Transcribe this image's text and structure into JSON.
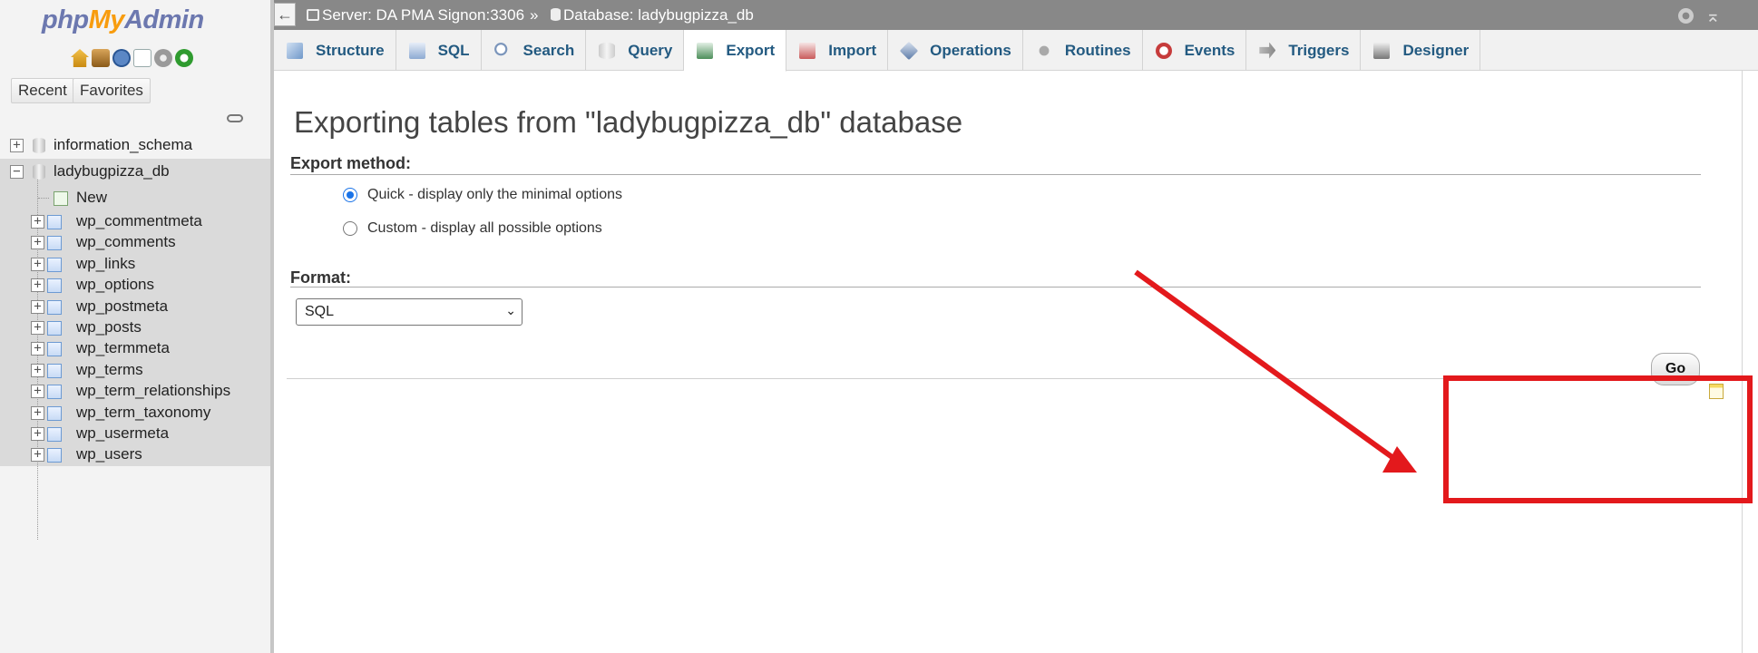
{
  "app": {
    "logo": {
      "php": "php",
      "my": "My",
      "admin": "Admin"
    },
    "quick_icons": [
      "home-icon",
      "database-icon",
      "docs-icon",
      "copy-icon",
      "settings-icon",
      "reload-icon"
    ]
  },
  "sidebar": {
    "recent_label": "Recent",
    "favorites_label": "Favorites",
    "databases": [
      {
        "name": "information_schema",
        "expanded": false
      },
      {
        "name": "ladybugpizza_db",
        "expanded": true
      }
    ],
    "new_label": "New",
    "tables": [
      "wp_commentmeta",
      "wp_comments",
      "wp_links",
      "wp_options",
      "wp_postmeta",
      "wp_posts",
      "wp_termmeta",
      "wp_terms",
      "wp_term_relationships",
      "wp_term_taxonomy",
      "wp_usermeta",
      "wp_users"
    ]
  },
  "breadcrumb": {
    "server": "Server: DA PMA Signon:3306",
    "separator": "»",
    "database": "Database: ladybugpizza_db"
  },
  "tabs": [
    {
      "label": "Structure",
      "icon": "structure-icon"
    },
    {
      "label": "SQL",
      "icon": "sql-icon"
    },
    {
      "label": "Search",
      "icon": "search-icon"
    },
    {
      "label": "Query",
      "icon": "query-icon"
    },
    {
      "label": "Export",
      "icon": "export-icon",
      "active": true
    },
    {
      "label": "Import",
      "icon": "import-icon"
    },
    {
      "label": "Operations",
      "icon": "operations-icon"
    },
    {
      "label": "Routines",
      "icon": "routines-icon"
    },
    {
      "label": "Events",
      "icon": "events-icon"
    },
    {
      "label": "Triggers",
      "icon": "triggers-icon"
    },
    {
      "label": "Designer",
      "icon": "designer-icon"
    }
  ],
  "main": {
    "title": "Exporting tables from \"ladybugpizza_db\" database",
    "export_method_label": "Export method:",
    "options": [
      {
        "label": "Quick - display only the minimal options",
        "checked": true
      },
      {
        "label": "Custom - display all possible options",
        "checked": false
      }
    ],
    "format_label": "Format:",
    "format_value": "SQL",
    "go_label": "Go"
  },
  "colors": {
    "tab_text": "#235a81",
    "annotation_red": "#e3191c",
    "topbar_bg": "#888888"
  }
}
